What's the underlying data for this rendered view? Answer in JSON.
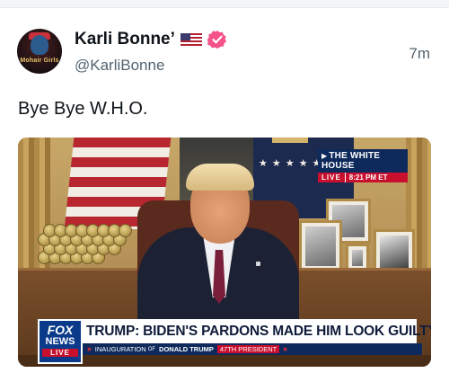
{
  "post": {
    "author": {
      "display_name": "Karli Bonne’",
      "handle": "@KarliBonne",
      "avatar_text": "Mohair Girls",
      "flag_emoji": "us-flag",
      "verified": true,
      "verified_color": "#f5528a"
    },
    "timestamp": "7m",
    "text": "Bye Bye W.H.O.",
    "media": {
      "type": "video-still",
      "broadcast_bug": {
        "location": "THE WHITE HOUSE",
        "status": "LIVE",
        "time": "8:21 PM ET"
      },
      "network_logo": {
        "line1": "FOX",
        "line2": "NEWS",
        "line3": "LIVE"
      },
      "headline": "TRUMP: BIDEN'S PARDONS MADE HIM LOOK GUILTY",
      "subline": {
        "prefix": "INAUGURATION",
        "of": "OF",
        "name": "DONALD TRUMP",
        "badge": "47TH PRESIDENT"
      }
    }
  }
}
